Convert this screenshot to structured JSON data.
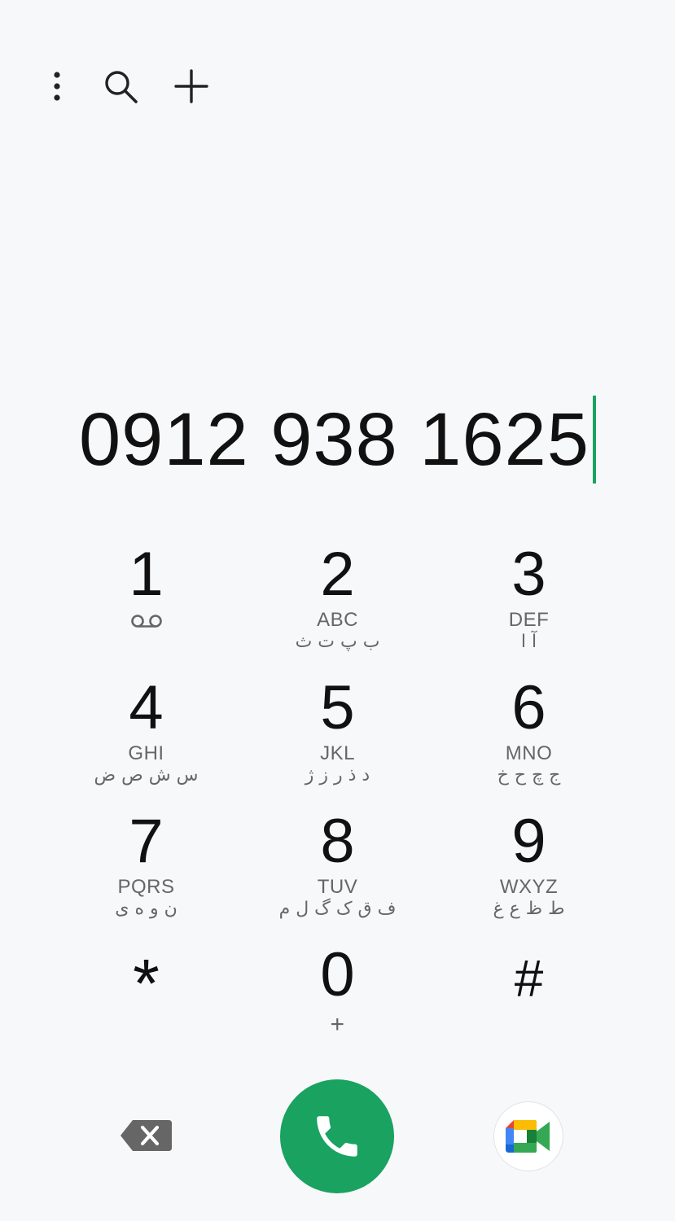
{
  "toolbar": {
    "more_icon": "more-vert-icon",
    "search_icon": "search-icon",
    "add_icon": "add-icon"
  },
  "dialer": {
    "number": "0912 938 1625",
    "accent_color": "#1aa260"
  },
  "keys": [
    {
      "digit": "1",
      "letters": "",
      "farsi": "",
      "sub_icon": "voicemail-icon"
    },
    {
      "digit": "2",
      "letters": "ABC",
      "farsi": "ب پ ت ث"
    },
    {
      "digit": "3",
      "letters": "DEF",
      "farsi": "آ ا"
    },
    {
      "digit": "4",
      "letters": "GHI",
      "farsi": "س ش ص ض"
    },
    {
      "digit": "5",
      "letters": "JKL",
      "farsi": "د ذ ر ز ژ"
    },
    {
      "digit": "6",
      "letters": "MNO",
      "farsi": "ج چ ح خ"
    },
    {
      "digit": "7",
      "letters": "PQRS",
      "farsi": "ن و ه ی"
    },
    {
      "digit": "8",
      "letters": "TUV",
      "farsi": "ف ق ک گ ل م"
    },
    {
      "digit": "9",
      "letters": "WXYZ",
      "farsi": "ط ظ ع غ"
    },
    {
      "digit": "*",
      "letters": "",
      "farsi": ""
    },
    {
      "digit": "0",
      "letters": "+",
      "farsi": ""
    },
    {
      "digit": "#",
      "letters": "",
      "farsi": ""
    }
  ],
  "actions": {
    "delete_icon": "backspace-icon",
    "call_icon": "phone-icon",
    "video_icon": "google-meet-icon"
  }
}
